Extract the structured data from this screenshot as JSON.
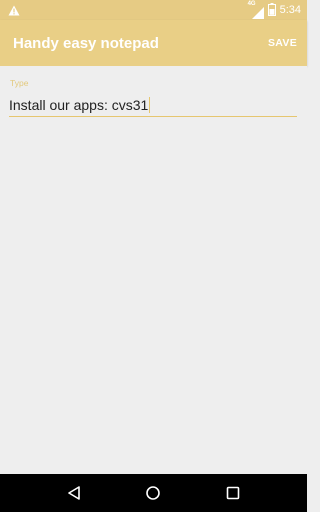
{
  "status_bar": {
    "time": "5:34",
    "network": "4G",
    "icons": [
      "warning-icon",
      "signal-icon",
      "battery-icon"
    ]
  },
  "app_bar": {
    "title": "Handy easy notepad",
    "save_label": "SAVE"
  },
  "editor": {
    "label": "Type",
    "value": "Install our apps: cvs31"
  },
  "nav_bar": {
    "icons": [
      "back-icon",
      "home-icon",
      "recents-icon"
    ]
  },
  "colors": {
    "accent": "#e9cf86",
    "underline": "#e6c66f",
    "background": "#eeeeee"
  }
}
